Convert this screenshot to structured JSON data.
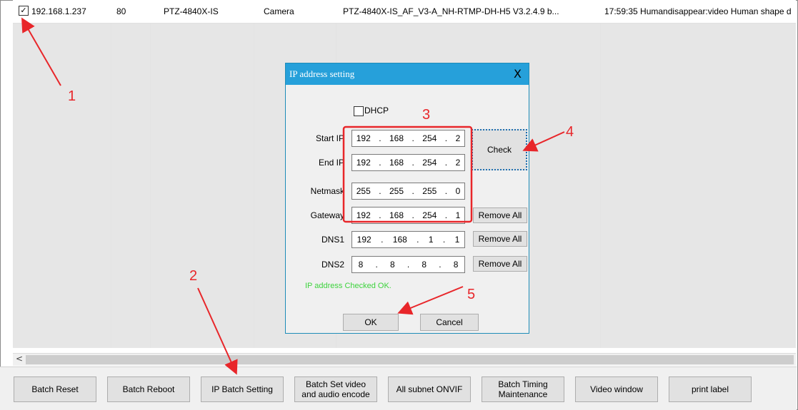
{
  "table": {
    "row": {
      "ip": "192.168.1.237",
      "port": "80",
      "model": "PTZ-4840X-IS",
      "type": "Camera",
      "firmware": "PTZ-4840X-IS_AF_V3-A_NH-RTMP-DH-H5 V3.2.4.9 b...",
      "event": "17:59:35 Humandisappear:video Human shape d",
      "checked": "✓"
    }
  },
  "scrollbar": {
    "left_arrow": "<"
  },
  "bottom_buttons": [
    "Batch Reset",
    "Batch Reboot",
    "IP Batch Setting",
    "Batch Set video and audio encode",
    "All subnet ONVIF",
    "Batch Timing Maintenance",
    "Video window",
    "print label"
  ],
  "dialog": {
    "title": "IP address setting",
    "close": "X",
    "dhcp_label": "DHCP",
    "fields": [
      {
        "label": "Start IP",
        "octets": [
          "192",
          "168",
          "254",
          "2"
        ]
      },
      {
        "label": "End IP",
        "octets": [
          "192",
          "168",
          "254",
          "2"
        ]
      },
      {
        "label": "Netmask",
        "octets": [
          "255",
          "255",
          "255",
          "0"
        ]
      },
      {
        "label": "Gateway",
        "octets": [
          "192",
          "168",
          "254",
          "1"
        ]
      },
      {
        "label": "DNS1",
        "octets": [
          "192",
          "168",
          "1",
          "1"
        ]
      },
      {
        "label": "DNS2",
        "octets": [
          "8",
          "8",
          "8",
          "8"
        ]
      }
    ],
    "check_button": "Check",
    "remove_all": "Remove All",
    "status": "IP address Checked OK.",
    "ok": "OK",
    "cancel": "Cancel"
  },
  "annotations": [
    "1",
    "2",
    "3",
    "4",
    "5"
  ],
  "colors": {
    "annotation": "#e8262a",
    "titlebar": "#26a0da",
    "status_ok": "#3dd33d"
  }
}
